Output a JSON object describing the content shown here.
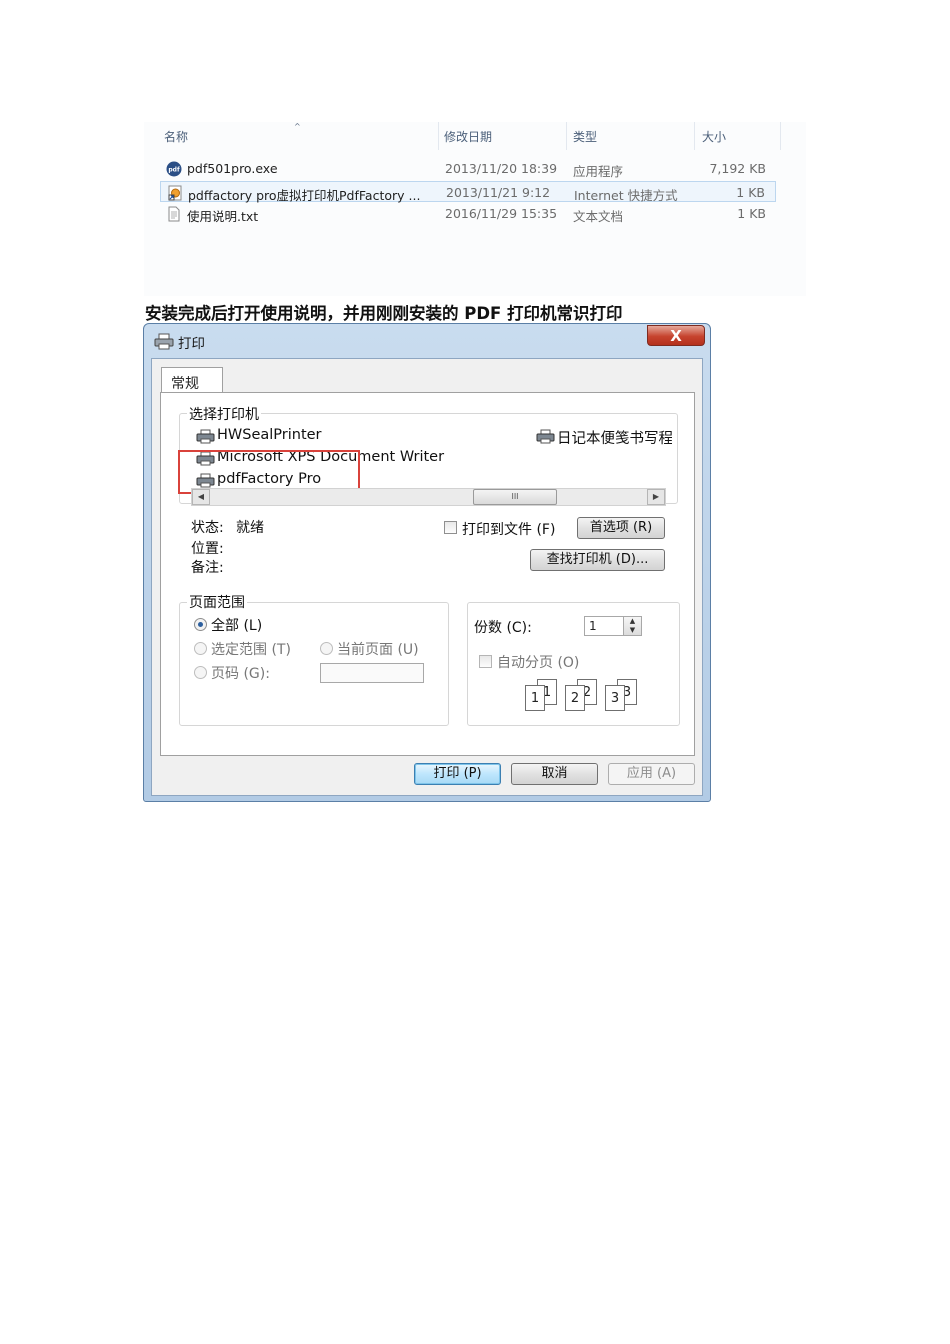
{
  "explorer": {
    "columns": {
      "name": "名称",
      "date": "修改日期",
      "type": "类型",
      "size": "大小"
    },
    "files": [
      {
        "name": "pdf501pro.exe",
        "date": "2013/11/20 18:39",
        "type": "应用程序",
        "size": "7,192 KB",
        "icon": "pdf-app-icon"
      },
      {
        "name": "pdffactory pro虚拟打印机PdfFactory ...",
        "date": "2013/11/21 9:12",
        "type": "Internet 快捷方式",
        "size": "1 KB",
        "icon": "internet-shortcut-icon"
      },
      {
        "name": "使用说明.txt",
        "date": "2016/11/29 15:35",
        "type": "文本文档",
        "size": "1 KB",
        "icon": "text-file-icon"
      }
    ],
    "selected_row": 1
  },
  "instruction": "安装完成后打开使用说明，并用刚刚安装的 PDF 打印机常识打印",
  "dialog": {
    "title": "打印",
    "close_label": "X",
    "tab": "常规",
    "printer_group": {
      "legend": "选择打印机",
      "printers": [
        "HWSealPrinter",
        "Microsoft XPS Document Writer",
        "pdfFactory Pro",
        "日记本便笺书写程"
      ],
      "highlighted": "pdfFactory Pro",
      "scroll_thumb": "III",
      "status_label": "状态:",
      "status_value": "就绪",
      "location_label": "位置:",
      "comment_label": "备注:",
      "print_to_file": "打印到文件 (F)",
      "preferences_button": "首选项 (R)",
      "find_printer_button": "查找打印机 (D)..."
    },
    "range_group": {
      "legend": "页面范围",
      "all": "全部 (L)",
      "selection": "选定范围 (T)",
      "current_page": "当前页面 (U)",
      "pages": "页码 (G):",
      "selected": "all"
    },
    "copies": {
      "label": "份数 (C):",
      "value": "1",
      "collate": "自动分页 (O)",
      "collate_pages": [
        "1",
        "1",
        "2",
        "2",
        "3",
        "3"
      ]
    },
    "buttons": {
      "print": "打印 (P)",
      "cancel": "取消",
      "apply": "应用 (A)"
    }
  },
  "colors": {
    "highlight": "#d9423b",
    "dialog_frame": "#b2cbe5",
    "close_button": "#c6432e"
  }
}
